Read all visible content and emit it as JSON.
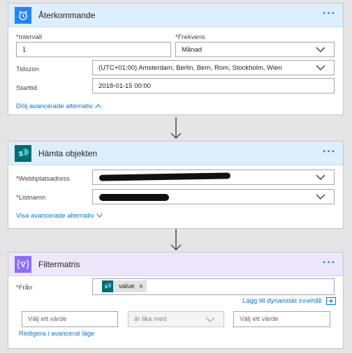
{
  "recurrence": {
    "title": "Återkommande",
    "more": "···",
    "interval_label": "Intervall",
    "interval_value": "1",
    "frequency_label": "Frekvens",
    "frequency_value": "Månad",
    "timezone_label": "Tidszon",
    "timezone_value": "(UTC+01:00) Amsterdam, Berlin, Bern, Rom, Stockholm, Wien",
    "starttime_label": "Starttid",
    "starttime_value": "2018-01-15 00:00",
    "hide_advanced": "Dölj avancerade alternativ",
    "header_color": "#ddeefc",
    "icon_color": "#1f85ff"
  },
  "get_items": {
    "title": "Hämta objekten",
    "more": "···",
    "site_label": "Webbplatsadress",
    "list_label": "Listnamn",
    "show_advanced": "Visa avancerade alternativ",
    "header_color": "#ddeefc",
    "icon_color": "#036c70"
  },
  "filter": {
    "title": "Filtermatris",
    "more": "···",
    "from_label": "Från",
    "token_label": "value",
    "token_close": "×",
    "add_dynamic": "Lägg till dynamiskt innehåll",
    "value_left_placeholder": "Välj ett värde",
    "operator": "är lika med",
    "value_right_placeholder": "Välj ett värde",
    "edit_advanced": "Redigera i avancerat läge",
    "header_color": "#ece7fb",
    "icon_color": "#8c6cff"
  },
  "colors": {
    "accent": "#0078d4",
    "required": "#d0021b"
  }
}
